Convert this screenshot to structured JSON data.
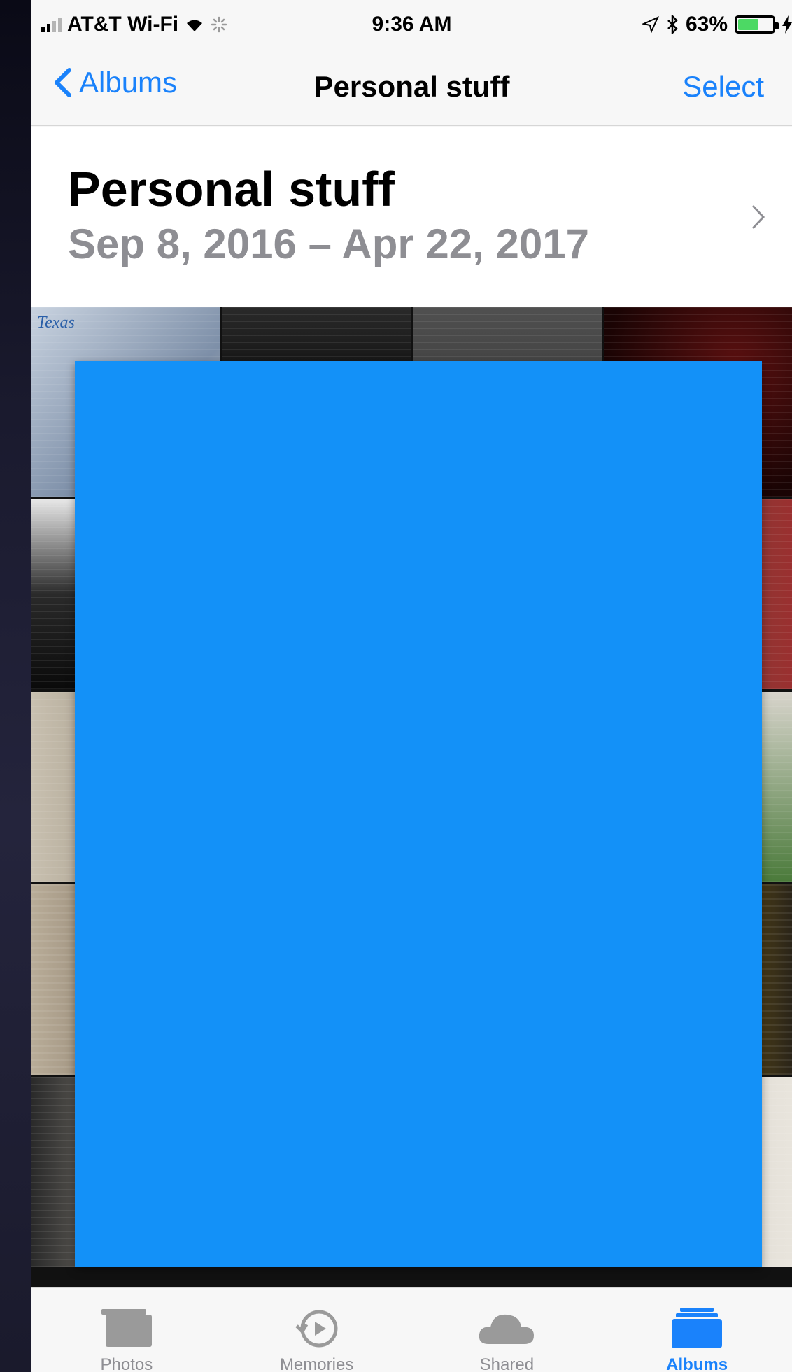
{
  "status_bar": {
    "carrier": "AT&T Wi-Fi",
    "time": "9:36 AM",
    "battery_percent": "63%",
    "battery_level": 0.63
  },
  "nav": {
    "back_label": "Albums",
    "title": "Personal stuff",
    "select_label": "Select"
  },
  "album": {
    "title": "Personal stuff",
    "dates": "Sep 8, 2016 – Apr 22, 2017"
  },
  "photo_grid": {
    "first_caption": "Texas"
  },
  "tabs": [
    {
      "label": "Photos",
      "icon": "photos-icon",
      "active": false
    },
    {
      "label": "Memories",
      "icon": "memories-icon",
      "active": false
    },
    {
      "label": "Shared",
      "icon": "cloud-icon",
      "active": false
    },
    {
      "label": "Albums",
      "icon": "albums-icon",
      "active": true
    }
  ],
  "colors": {
    "accent": "#1a82fb",
    "overlay": "#1391f8",
    "inactive": "#8e8e93"
  }
}
